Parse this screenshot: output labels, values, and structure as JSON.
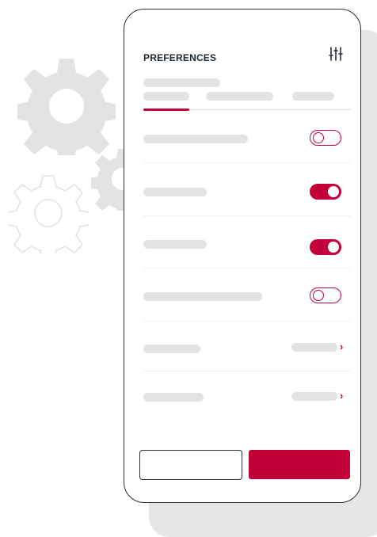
{
  "header": {
    "title": "PREFERENCES",
    "filter_icon": "sliders-icon"
  },
  "tabs": {
    "active_index": 0,
    "count": 3
  },
  "settings": [
    {
      "kind": "toggle",
      "state": "off"
    },
    {
      "kind": "toggle",
      "state": "on"
    },
    {
      "kind": "toggle",
      "state": "on"
    },
    {
      "kind": "toggle",
      "state": "off"
    },
    {
      "kind": "link",
      "icon": "chevron-right-icon"
    },
    {
      "kind": "link",
      "icon": "chevron-right-icon"
    }
  ],
  "footer": {
    "secondary_label": "",
    "primary_label": ""
  },
  "colors": {
    "accent": "#c4003a",
    "skeleton": "#e3e3e3",
    "gear_fill": "#e3e3e3",
    "gear_outline": "#e3e3e3"
  }
}
